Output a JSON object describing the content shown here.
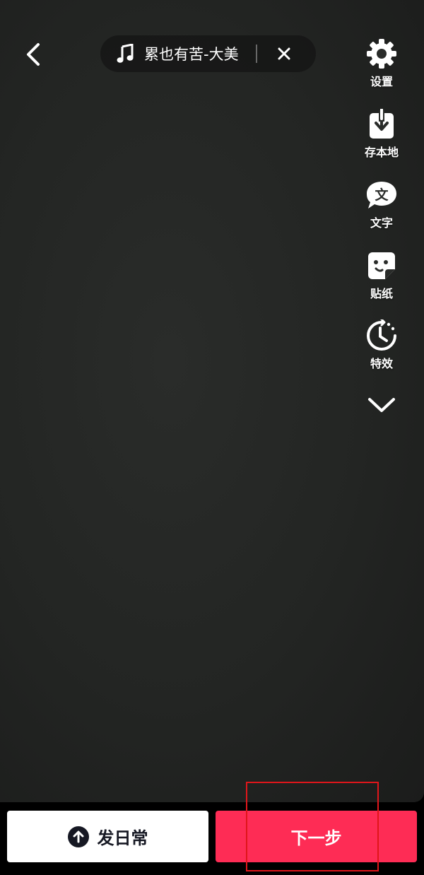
{
  "music": {
    "title": "累也有苦-大美"
  },
  "tools": [
    {
      "label": "设置",
      "icon": "gear-icon"
    },
    {
      "label": "存本地",
      "icon": "save-local-icon"
    },
    {
      "label": "文字",
      "icon": "text-icon",
      "glyph": "文"
    },
    {
      "label": "贴纸",
      "icon": "sticker-icon"
    },
    {
      "label": "特效",
      "icon": "effects-timer-icon"
    }
  ],
  "bottom": {
    "daily_label": "发日常",
    "next_label": "下一步"
  },
  "colors": {
    "accent": "#fe2c55",
    "annotation": "#e0161b"
  }
}
